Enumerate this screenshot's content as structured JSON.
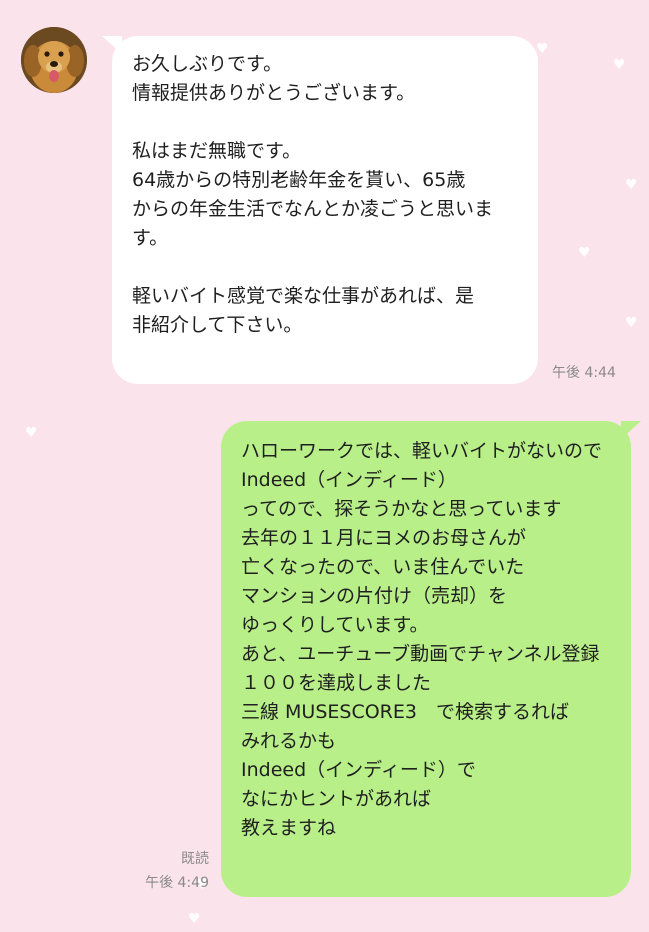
{
  "colors": {
    "background": "#fbe3ec",
    "incoming_bubble": "#ffffff",
    "outgoing_bubble": "#b8ef88",
    "meta_text": "#8a8a8a"
  },
  "messages": [
    {
      "direction": "incoming",
      "text": "お久しぶりです。\n情報提供ありがとうございます。\n\n私はまだ無職です。\n64歳からの特別老齢年金を貰い、65歳\nからの年金生活でなんとか凌ごうと思いま\nす。\n\n軽いバイト感覚で楽な仕事があれば、是\n非紹介して下さい。",
      "time": "午後 4:44"
    },
    {
      "direction": "outgoing",
      "text": "ハローワークでは、軽いバイトがないので\nIndeed（インディード）\nってので、探そうかなと思っています\n去年の１１月にヨメのお母さんが\n亡くなったので、いま住んでいた\nマンションの片付け（売却）を\nゆっくりしています。\nあと、ユーチューブ動画でチャンネル登録\n１００を達成しました\n三線 MUSESCORE3　で検索するれば\nみれるかも\nIndeed（インディード）で\nなにかヒントがあれば\n教えますね",
      "read_label": "既読",
      "time": "午後 4:49"
    }
  ]
}
